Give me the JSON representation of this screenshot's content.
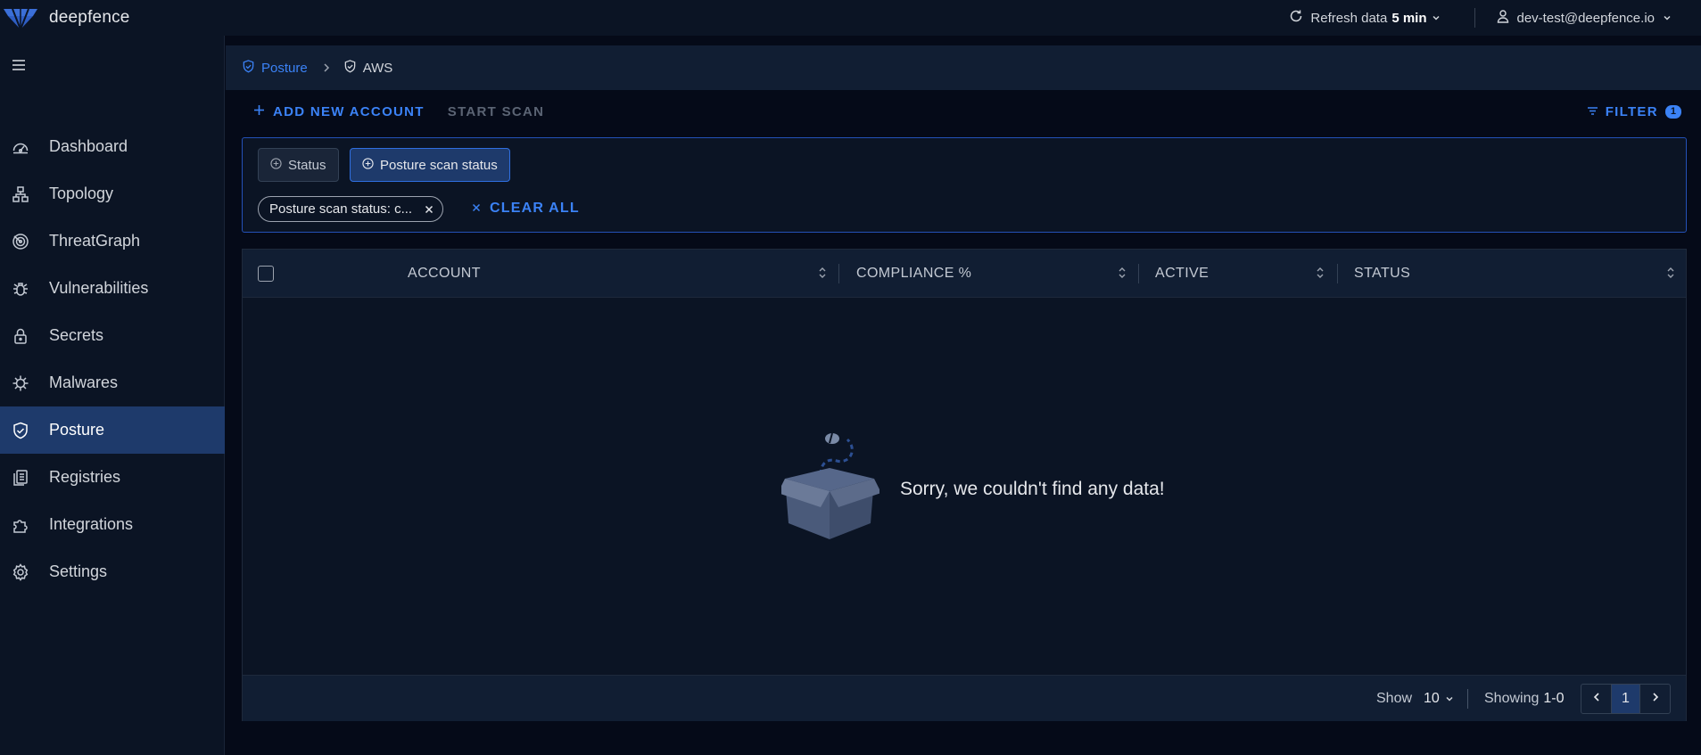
{
  "app": {
    "name": "deepfence"
  },
  "topbar": {
    "refresh_label": "Refresh data",
    "refresh_value": "5 min",
    "user_email": "dev-test@deepfence.io"
  },
  "sidebar": {
    "items": [
      {
        "label": "Dashboard",
        "icon": "dashboard-icon"
      },
      {
        "label": "Topology",
        "icon": "topology-icon"
      },
      {
        "label": "ThreatGraph",
        "icon": "threatgraph-icon"
      },
      {
        "label": "Vulnerabilities",
        "icon": "bug-icon"
      },
      {
        "label": "Secrets",
        "icon": "lock-icon"
      },
      {
        "label": "Malwares",
        "icon": "virus-icon"
      },
      {
        "label": "Posture",
        "icon": "shield-check-icon",
        "active": true
      },
      {
        "label": "Registries",
        "icon": "registry-icon"
      },
      {
        "label": "Integrations",
        "icon": "puzzle-icon"
      },
      {
        "label": "Settings",
        "icon": "gear-icon"
      }
    ]
  },
  "breadcrumb": {
    "parent": "Posture",
    "current": "AWS"
  },
  "actions": {
    "add_account": "ADD NEW ACCOUNT",
    "start_scan": "START SCAN",
    "filter": "FILTER",
    "filter_count": "1"
  },
  "filters": {
    "chips": [
      "Status",
      "Posture scan status"
    ],
    "applied_tag": "Posture scan status: c...",
    "clear_all": "CLEAR ALL"
  },
  "table": {
    "columns": [
      "ACCOUNT",
      "COMPLIANCE %",
      "ACTIVE",
      "STATUS"
    ],
    "empty_message": "Sorry, we couldn't find any data!",
    "footer": {
      "show_label": "Show",
      "page_size": "10",
      "showing_label": "Showing",
      "showing_range": "1-0",
      "current_page": "1"
    }
  },
  "colors": {
    "accent": "#3b82f6",
    "active_nav": "#1e3a6b",
    "background": "#050a18",
    "panel": "#0b1424"
  }
}
